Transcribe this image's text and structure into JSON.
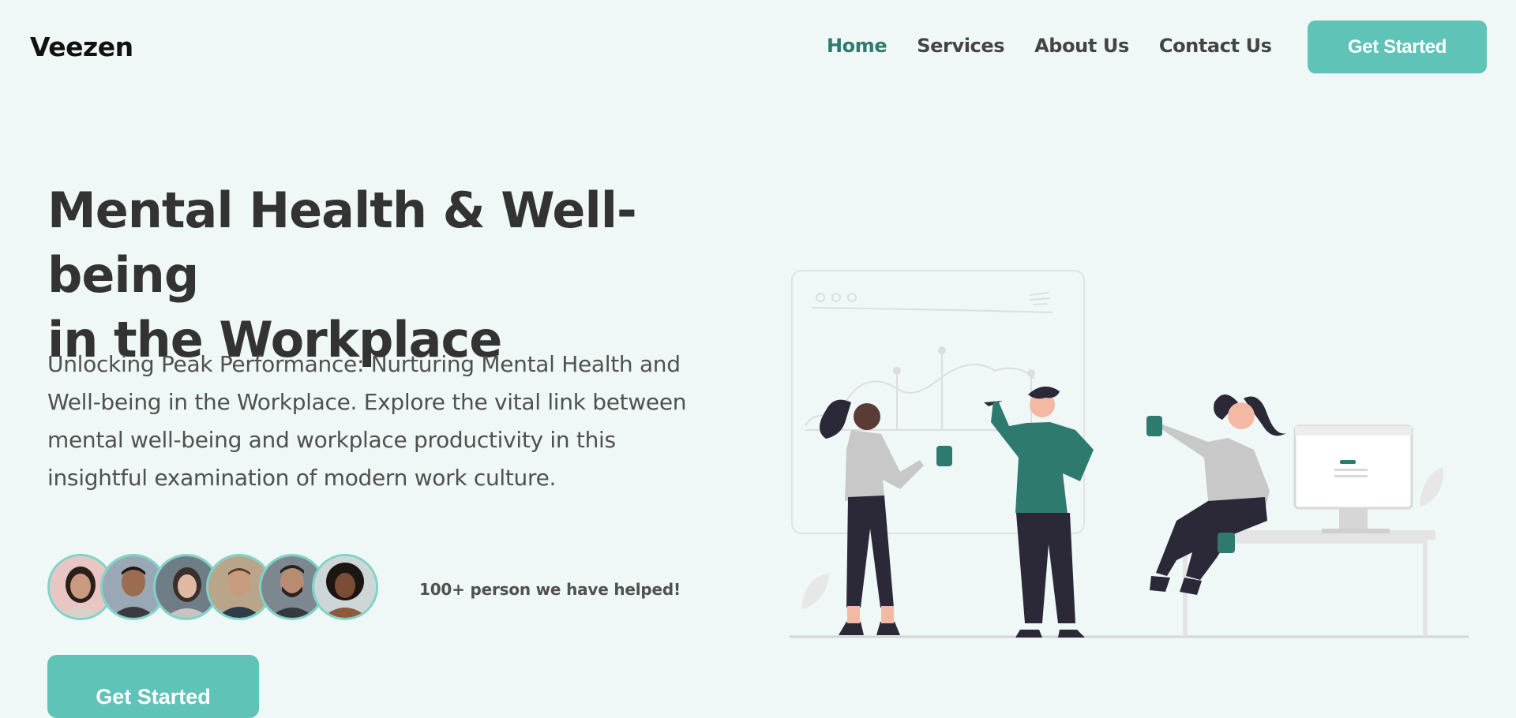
{
  "brand": {
    "name": "Veezen",
    "accent": "#5fc3b8",
    "accent_dark": "#2f7a6f",
    "background": "#eff8f6"
  },
  "nav": {
    "links": [
      {
        "label": "Home",
        "active": true
      },
      {
        "label": "Services",
        "active": false
      },
      {
        "label": "About Us",
        "active": false
      },
      {
        "label": "Contact Us",
        "active": false
      }
    ],
    "cta_label": "Get Started"
  },
  "hero": {
    "title_line1": "Mental Health & Well-being",
    "title_line2": "in the Workplace",
    "description": "Unlocking Peak Performance: Nurturing Mental Health and Well-being in the Workplace. Explore the vital link between mental well-being and workplace productivity in this insightful examination of modern work culture.",
    "helped_text": "100+ person we have helped!",
    "cta_label": "Get Started",
    "avatar_count": 6
  },
  "illustration": {
    "icon": "team-collaboration-illustration"
  }
}
